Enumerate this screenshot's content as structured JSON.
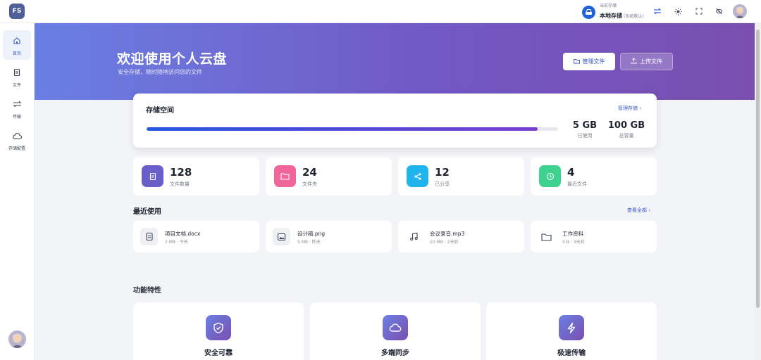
{
  "topbar": {
    "logo_text": "FS",
    "storage_caption": "当前存储",
    "storage_name": "本地存储",
    "storage_sub": "(系统默认)"
  },
  "sidebar": {
    "items": [
      {
        "label": "首页",
        "icon": "home-icon"
      },
      {
        "label": "文件",
        "icon": "file-icon"
      },
      {
        "label": "传输",
        "icon": "transfer-icon"
      },
      {
        "label": "存储配置",
        "icon": "cloud-icon"
      }
    ]
  },
  "hero": {
    "title": "欢迎使用个人云盘",
    "subtitle": "安全存储，随时随地访问您的文件",
    "manage_btn": "管理文件",
    "upload_btn": "上传文件"
  },
  "storage": {
    "title": "存储空间",
    "manage_link": "管理存储 ›",
    "used_value": "5 GB",
    "used_label": "已使用",
    "total_value": "100 GB",
    "total_label": "总容量",
    "progress_percent": 95
  },
  "stats": [
    {
      "value": "128",
      "label": "文件数量",
      "color": "#6a5fc9"
    },
    {
      "value": "24",
      "label": "文件夹",
      "color": "#f0669a"
    },
    {
      "value": "12",
      "label": "已分享",
      "color": "#1fb4ee"
    },
    {
      "value": "4",
      "label": "最近文件",
      "color": "#3fd18f"
    }
  ],
  "recent": {
    "title": "最近使用",
    "view_all": "查看全部 ›",
    "items": [
      {
        "name": "项目文档.docx",
        "meta": "2 MB · 今天",
        "icon": "document-icon"
      },
      {
        "name": "设计稿.png",
        "meta": "5 MB · 昨天",
        "icon": "image-icon"
      },
      {
        "name": "会议录音.mp3",
        "meta": "10 MB · 2天前",
        "icon": "music-icon"
      },
      {
        "name": "工作资料",
        "meta": "0 B · 3天前",
        "icon": "folder-icon"
      }
    ]
  },
  "features": {
    "title": "功能特性",
    "items": [
      {
        "title": "安全可靠",
        "icon": "shield-icon"
      },
      {
        "title": "多端同步",
        "icon": "cloud-icon"
      },
      {
        "title": "极速传输",
        "icon": "lightning-icon"
      }
    ]
  }
}
